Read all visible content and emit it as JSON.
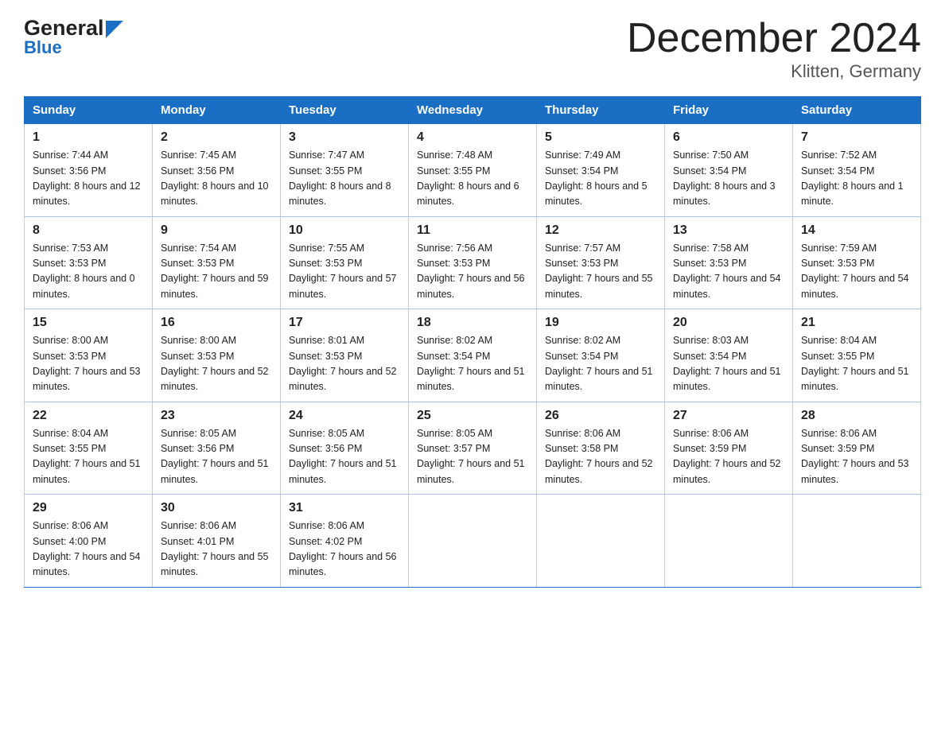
{
  "header": {
    "logo_line1": "General",
    "logo_line2": "Blue",
    "title": "December 2024",
    "subtitle": "Klitten, Germany"
  },
  "days_of_week": [
    "Sunday",
    "Monday",
    "Tuesday",
    "Wednesday",
    "Thursday",
    "Friday",
    "Saturday"
  ],
  "weeks": [
    [
      {
        "num": "1",
        "sunrise": "Sunrise: 7:44 AM",
        "sunset": "Sunset: 3:56 PM",
        "daylight": "Daylight: 8 hours and 12 minutes."
      },
      {
        "num": "2",
        "sunrise": "Sunrise: 7:45 AM",
        "sunset": "Sunset: 3:56 PM",
        "daylight": "Daylight: 8 hours and 10 minutes."
      },
      {
        "num": "3",
        "sunrise": "Sunrise: 7:47 AM",
        "sunset": "Sunset: 3:55 PM",
        "daylight": "Daylight: 8 hours and 8 minutes."
      },
      {
        "num": "4",
        "sunrise": "Sunrise: 7:48 AM",
        "sunset": "Sunset: 3:55 PM",
        "daylight": "Daylight: 8 hours and 6 minutes."
      },
      {
        "num": "5",
        "sunrise": "Sunrise: 7:49 AM",
        "sunset": "Sunset: 3:54 PM",
        "daylight": "Daylight: 8 hours and 5 minutes."
      },
      {
        "num": "6",
        "sunrise": "Sunrise: 7:50 AM",
        "sunset": "Sunset: 3:54 PM",
        "daylight": "Daylight: 8 hours and 3 minutes."
      },
      {
        "num": "7",
        "sunrise": "Sunrise: 7:52 AM",
        "sunset": "Sunset: 3:54 PM",
        "daylight": "Daylight: 8 hours and 1 minute."
      }
    ],
    [
      {
        "num": "8",
        "sunrise": "Sunrise: 7:53 AM",
        "sunset": "Sunset: 3:53 PM",
        "daylight": "Daylight: 8 hours and 0 minutes."
      },
      {
        "num": "9",
        "sunrise": "Sunrise: 7:54 AM",
        "sunset": "Sunset: 3:53 PM",
        "daylight": "Daylight: 7 hours and 59 minutes."
      },
      {
        "num": "10",
        "sunrise": "Sunrise: 7:55 AM",
        "sunset": "Sunset: 3:53 PM",
        "daylight": "Daylight: 7 hours and 57 minutes."
      },
      {
        "num": "11",
        "sunrise": "Sunrise: 7:56 AM",
        "sunset": "Sunset: 3:53 PM",
        "daylight": "Daylight: 7 hours and 56 minutes."
      },
      {
        "num": "12",
        "sunrise": "Sunrise: 7:57 AM",
        "sunset": "Sunset: 3:53 PM",
        "daylight": "Daylight: 7 hours and 55 minutes."
      },
      {
        "num": "13",
        "sunrise": "Sunrise: 7:58 AM",
        "sunset": "Sunset: 3:53 PM",
        "daylight": "Daylight: 7 hours and 54 minutes."
      },
      {
        "num": "14",
        "sunrise": "Sunrise: 7:59 AM",
        "sunset": "Sunset: 3:53 PM",
        "daylight": "Daylight: 7 hours and 54 minutes."
      }
    ],
    [
      {
        "num": "15",
        "sunrise": "Sunrise: 8:00 AM",
        "sunset": "Sunset: 3:53 PM",
        "daylight": "Daylight: 7 hours and 53 minutes."
      },
      {
        "num": "16",
        "sunrise": "Sunrise: 8:00 AM",
        "sunset": "Sunset: 3:53 PM",
        "daylight": "Daylight: 7 hours and 52 minutes."
      },
      {
        "num": "17",
        "sunrise": "Sunrise: 8:01 AM",
        "sunset": "Sunset: 3:53 PM",
        "daylight": "Daylight: 7 hours and 52 minutes."
      },
      {
        "num": "18",
        "sunrise": "Sunrise: 8:02 AM",
        "sunset": "Sunset: 3:54 PM",
        "daylight": "Daylight: 7 hours and 51 minutes."
      },
      {
        "num": "19",
        "sunrise": "Sunrise: 8:02 AM",
        "sunset": "Sunset: 3:54 PM",
        "daylight": "Daylight: 7 hours and 51 minutes."
      },
      {
        "num": "20",
        "sunrise": "Sunrise: 8:03 AM",
        "sunset": "Sunset: 3:54 PM",
        "daylight": "Daylight: 7 hours and 51 minutes."
      },
      {
        "num": "21",
        "sunrise": "Sunrise: 8:04 AM",
        "sunset": "Sunset: 3:55 PM",
        "daylight": "Daylight: 7 hours and 51 minutes."
      }
    ],
    [
      {
        "num": "22",
        "sunrise": "Sunrise: 8:04 AM",
        "sunset": "Sunset: 3:55 PM",
        "daylight": "Daylight: 7 hours and 51 minutes."
      },
      {
        "num": "23",
        "sunrise": "Sunrise: 8:05 AM",
        "sunset": "Sunset: 3:56 PM",
        "daylight": "Daylight: 7 hours and 51 minutes."
      },
      {
        "num": "24",
        "sunrise": "Sunrise: 8:05 AM",
        "sunset": "Sunset: 3:56 PM",
        "daylight": "Daylight: 7 hours and 51 minutes."
      },
      {
        "num": "25",
        "sunrise": "Sunrise: 8:05 AM",
        "sunset": "Sunset: 3:57 PM",
        "daylight": "Daylight: 7 hours and 51 minutes."
      },
      {
        "num": "26",
        "sunrise": "Sunrise: 8:06 AM",
        "sunset": "Sunset: 3:58 PM",
        "daylight": "Daylight: 7 hours and 52 minutes."
      },
      {
        "num": "27",
        "sunrise": "Sunrise: 8:06 AM",
        "sunset": "Sunset: 3:59 PM",
        "daylight": "Daylight: 7 hours and 52 minutes."
      },
      {
        "num": "28",
        "sunrise": "Sunrise: 8:06 AM",
        "sunset": "Sunset: 3:59 PM",
        "daylight": "Daylight: 7 hours and 53 minutes."
      }
    ],
    [
      {
        "num": "29",
        "sunrise": "Sunrise: 8:06 AM",
        "sunset": "Sunset: 4:00 PM",
        "daylight": "Daylight: 7 hours and 54 minutes."
      },
      {
        "num": "30",
        "sunrise": "Sunrise: 8:06 AM",
        "sunset": "Sunset: 4:01 PM",
        "daylight": "Daylight: 7 hours and 55 minutes."
      },
      {
        "num": "31",
        "sunrise": "Sunrise: 8:06 AM",
        "sunset": "Sunset: 4:02 PM",
        "daylight": "Daylight: 7 hours and 56 minutes."
      },
      null,
      null,
      null,
      null
    ]
  ]
}
